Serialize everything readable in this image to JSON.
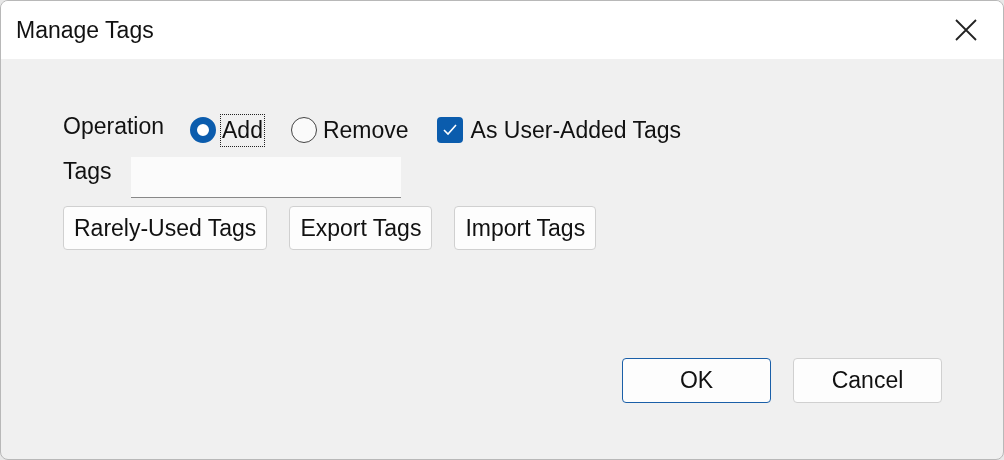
{
  "window": {
    "title": "Manage Tags"
  },
  "operation": {
    "label": "Operation",
    "options": [
      {
        "label": "Add",
        "selected": true,
        "focused": true
      },
      {
        "label": "Remove",
        "selected": false,
        "focused": false
      }
    ]
  },
  "user_added": {
    "label": "As User-Added Tags",
    "checked": true
  },
  "tags_field": {
    "label": "Tags"
  },
  "tag_buttons": [
    "Rarely-Used Tags",
    "Export Tags",
    "Import Tags"
  ],
  "footer_buttons": [
    {
      "label": "OK",
      "default": true
    },
    {
      "label": "Cancel",
      "default": false
    }
  ]
}
